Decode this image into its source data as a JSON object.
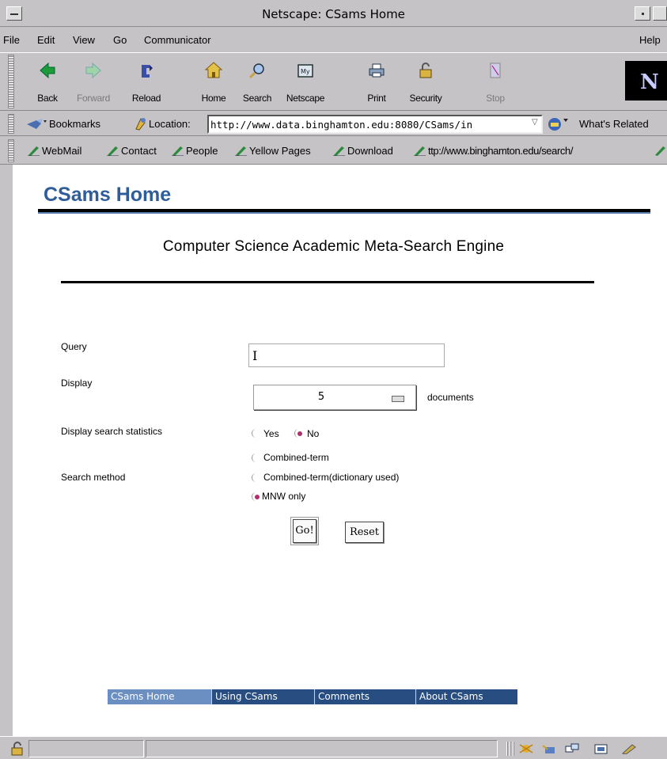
{
  "window": {
    "title": "Netscape: CSams Home"
  },
  "menu": {
    "items": [
      "File",
      "Edit",
      "View",
      "Go",
      "Communicator"
    ],
    "help": "Help"
  },
  "nav": {
    "buttons": [
      {
        "label": "Back",
        "icon": "back-arrow-icon",
        "enabled": true
      },
      {
        "label": "Forward",
        "icon": "forward-arrow-icon",
        "enabled": false
      },
      {
        "label": "Reload",
        "icon": "reload-icon",
        "enabled": true
      },
      {
        "label": "Home",
        "icon": "home-icon",
        "enabled": true
      },
      {
        "label": "Search",
        "icon": "search-icon",
        "enabled": true
      },
      {
        "label": "Netscape",
        "icon": "netscape-icon",
        "enabled": true
      },
      {
        "label": "Print",
        "icon": "print-icon",
        "enabled": true
      },
      {
        "label": "Security",
        "icon": "security-icon",
        "enabled": true
      },
      {
        "label": "Stop",
        "icon": "stop-icon",
        "enabled": false
      }
    ],
    "logo": "N"
  },
  "location": {
    "bookmarks_label": "Bookmarks",
    "location_label": "Location:",
    "url": "http://www.data.binghamton.edu:8080/CSams/in",
    "related_label": "What's Related"
  },
  "personal": {
    "items": [
      "WebMail",
      "Contact",
      "People",
      "Yellow Pages",
      "Download",
      "ttp://www.binghamton.edu/search/"
    ]
  },
  "page": {
    "heading": "CSams Home",
    "subtitle": "Computer Science Academic Meta-Search Engine",
    "form": {
      "query_label": "Query",
      "query_value": "I",
      "display_label": "Display",
      "display_value": "5",
      "display_suffix": "documents",
      "stats_label": "Display search statistics",
      "stats_yes": "Yes",
      "stats_no": "No",
      "method_label": "Search method",
      "method_options": [
        "Combined-term",
        "Combined-term(dictionary used)",
        "MNW only"
      ],
      "go_label": "Go!",
      "reset_label": "Reset"
    },
    "footer_nav": [
      "CSams Home",
      "Using CSams",
      "Comments",
      "About CSams"
    ]
  },
  "colors": {
    "heading": "#2f5d9a",
    "footer_bg": "#284d80",
    "footer_current": "#6c8fc1",
    "radio_selected": "#b0306a",
    "chrome": "#c6c3c6"
  }
}
